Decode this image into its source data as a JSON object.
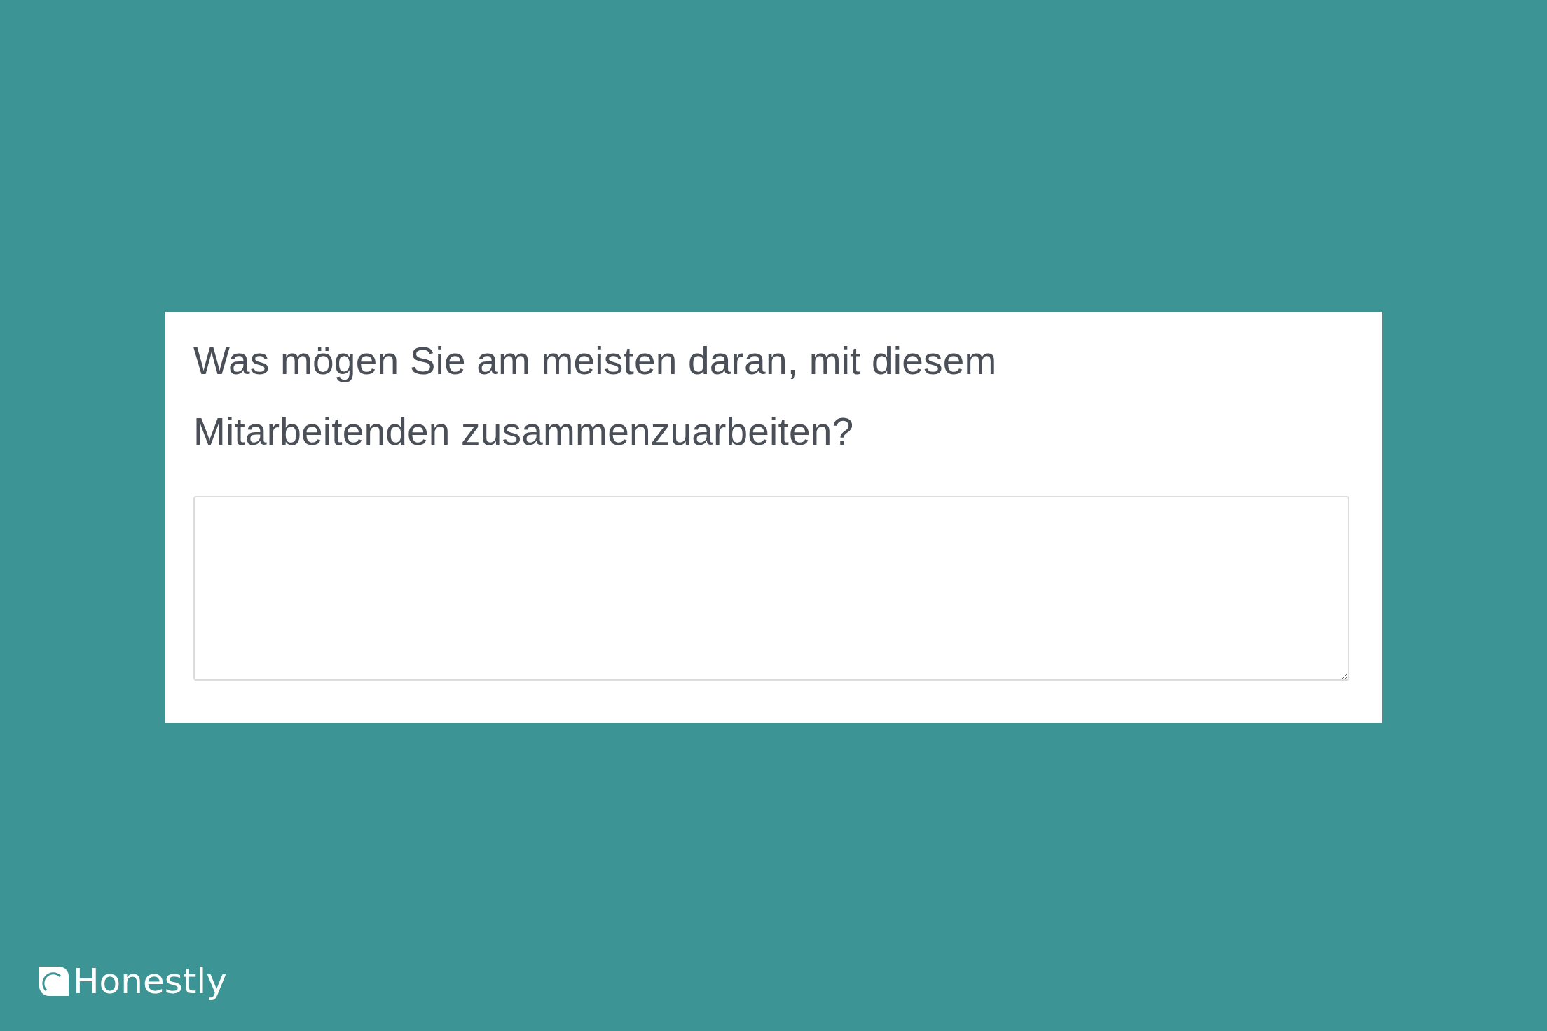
{
  "question": "Was mögen Sie am meisten daran, mit diesem Mitarbeitenden zusammenzuarbeiten?",
  "logo": {
    "text": "Honestly"
  }
}
